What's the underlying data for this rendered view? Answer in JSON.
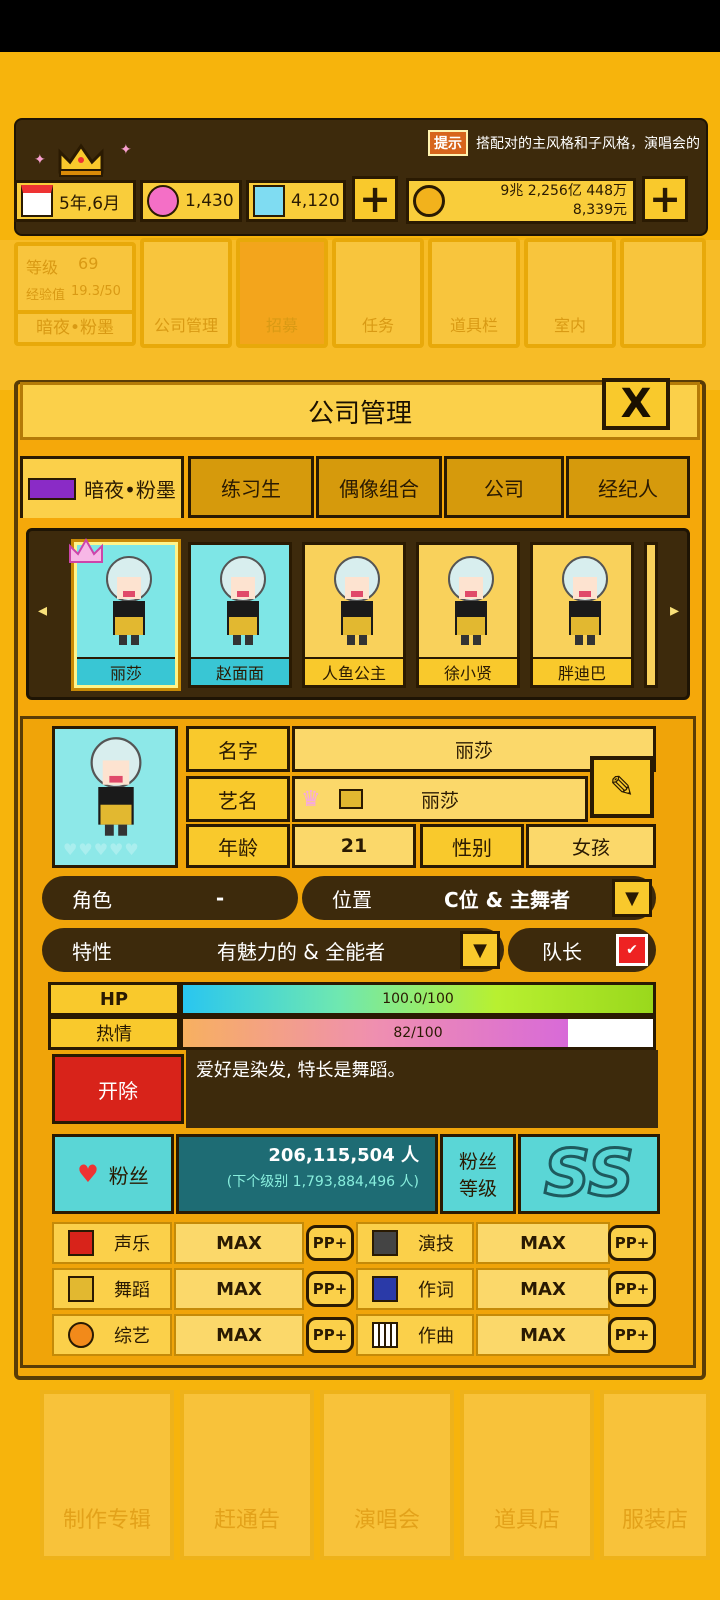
{
  "hud": {
    "hint_tag": "提示",
    "hint_text": "搭配对的主风格和子风格，演唱会的",
    "date": "5年,6月",
    "gems_pink": "1,430",
    "gems_blue": "4,120",
    "money_line1": "9兆 2,256亿 448万",
    "money_line2": "8,339元"
  },
  "background_menu": {
    "level_label": "等级",
    "level_value": "69",
    "exp_label": "经验值",
    "exp_value": "19.3/50",
    "group_name": "暗夜•粉墨",
    "items": [
      "公司管理",
      "招募",
      "任务",
      "道具栏",
      "室内"
    ]
  },
  "dialog": {
    "title": "公司管理",
    "close_label": "X",
    "tabs": [
      "暗夜•粉墨",
      "练习生",
      "偶像组合",
      "公司",
      "经纪人"
    ]
  },
  "members": [
    "丽莎",
    "赵面面",
    "人鱼公主",
    "徐小贤",
    "胖迪巴"
  ],
  "profile": {
    "name_label": "名字",
    "name_value": "丽莎",
    "stage_label": "艺名",
    "stage_value": "丽莎",
    "age_label": "年龄",
    "age_value": "21",
    "gender_label": "性别",
    "gender_value": "女孩",
    "role_label": "角色",
    "role_value": "-",
    "position_label": "位置",
    "position_value": "C位 & 主舞者",
    "trait_label": "特性",
    "trait_value": "有魅力的 & 全能者",
    "leader_label": "队长",
    "hp_label": "HP",
    "hp_text": "100.0/100",
    "hp_fraction": 1.0,
    "passion_label": "热情",
    "passion_text": "82/100",
    "passion_fraction": 0.82,
    "description": "爱好是染发, 特长是舞蹈。",
    "fire_label": "开除"
  },
  "fans": {
    "label": "粉丝",
    "count": "206,115,504 人",
    "next": "(下个级别 1,793,884,496 人)",
    "level_label_1": "粉丝",
    "level_label_2": "等级",
    "grade": "SS"
  },
  "skills": [
    {
      "name": "声乐",
      "value": "MAX",
      "pp": "PP+"
    },
    {
      "name": "演技",
      "value": "MAX",
      "pp": "PP+"
    },
    {
      "name": "舞蹈",
      "value": "MAX",
      "pp": "PP+"
    },
    {
      "name": "作词",
      "value": "MAX",
      "pp": "PP+"
    },
    {
      "name": "综艺",
      "value": "MAX",
      "pp": "PP+"
    },
    {
      "name": "作曲",
      "value": "MAX",
      "pp": "PP+"
    }
  ],
  "bottom_menu": [
    "制作专辑",
    "赶通告",
    "演唱会",
    "道具店",
    "服装店"
  ]
}
